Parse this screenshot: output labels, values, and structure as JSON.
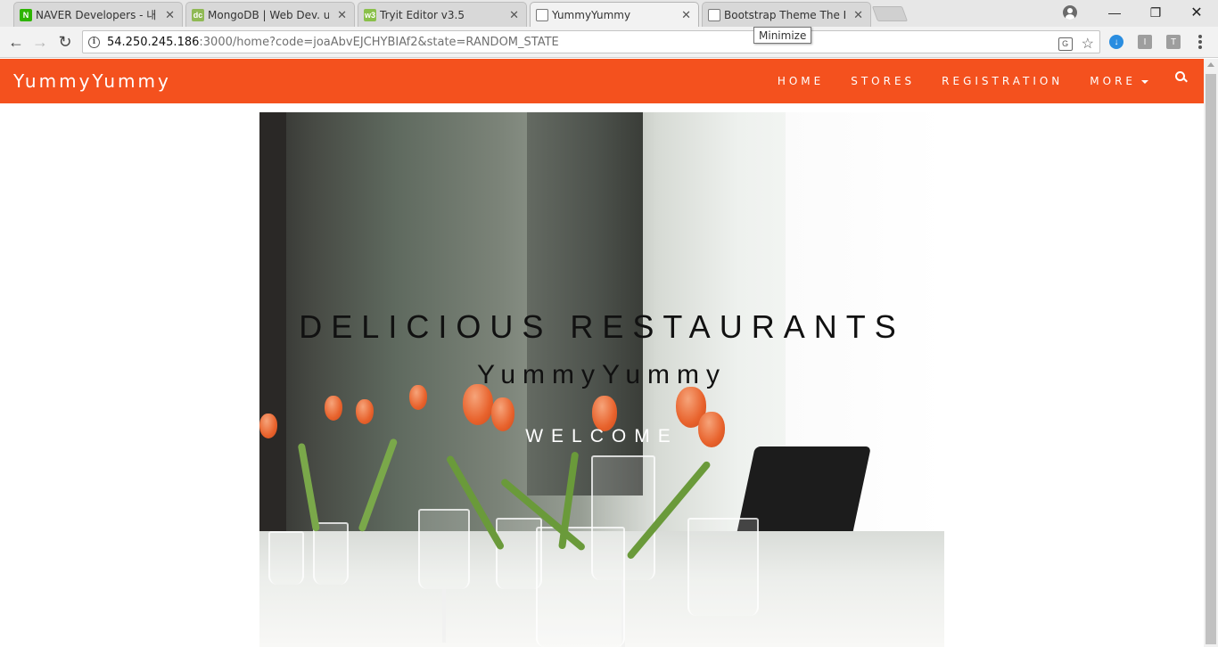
{
  "browser": {
    "tabs": [
      {
        "title": "NAVER Developers - 내",
        "favicon": "naver-favicon",
        "favicon_color": "#2db400"
      },
      {
        "title": "MongoDB | Web Dev. u",
        "favicon": "mongodb-favicon",
        "favicon_color": "#8fb954"
      },
      {
        "title": "Tryit Editor v3.5",
        "favicon": "w3schools-favicon",
        "favicon_color": "#8ac04a"
      },
      {
        "title": "YummyYummy",
        "favicon": "page-favicon",
        "active": true
      },
      {
        "title": "Bootstrap Theme The B",
        "favicon": "page-favicon"
      }
    ],
    "url_host": "54.250.245.186",
    "url_rest": ":3000/home?code=joaAbvEJCHYBIAf2&state=RANDOM_STATE",
    "tooltip": "Minimize",
    "extensions": [
      {
        "name": "download-extension-icon",
        "label": "",
        "color": "#2a8de0"
      },
      {
        "name": "extension-i-icon",
        "label": "I",
        "color": "#9e9e9e"
      },
      {
        "name": "extension-t-icon",
        "label": "T",
        "color": "#9e9e9e"
      }
    ]
  },
  "page": {
    "brand": "YummyYummy",
    "brand_color": "#f4511e",
    "nav": {
      "home": "HOME",
      "stores": "STORES",
      "registration": "REGISTRATION",
      "more": "MORE"
    },
    "hero": {
      "title": "DELICIOUS RESTAURANTS",
      "subtitle": "YummyYummy",
      "welcome": "WELCOME"
    }
  }
}
